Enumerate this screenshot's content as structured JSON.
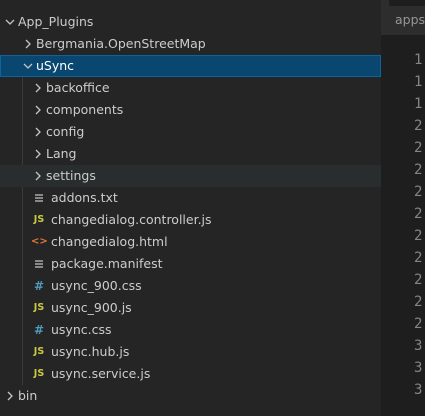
{
  "explorer": {
    "root_folder": "App_Plugins",
    "items": [
      {
        "label": "Bergmania.OpenStreetMap",
        "kind": "folder",
        "expanded": false
      },
      {
        "label": "uSync",
        "kind": "folder",
        "expanded": true,
        "selected": true
      },
      {
        "label": "backoffice",
        "kind": "folder",
        "expanded": false
      },
      {
        "label": "components",
        "kind": "folder",
        "expanded": false
      },
      {
        "label": "config",
        "kind": "folder",
        "expanded": false
      },
      {
        "label": "Lang",
        "kind": "folder",
        "expanded": false
      },
      {
        "label": "settings",
        "kind": "folder",
        "expanded": false,
        "hover": true
      },
      {
        "label": "addons.txt",
        "kind": "file",
        "icon": "lines-icon"
      },
      {
        "label": "changedialog.controller.js",
        "kind": "file",
        "icon": "js-icon"
      },
      {
        "label": "changedialog.html",
        "kind": "file",
        "icon": "html-icon"
      },
      {
        "label": "package.manifest",
        "kind": "file",
        "icon": "lines-icon"
      },
      {
        "label": "usync_900.css",
        "kind": "file",
        "icon": "css-icon"
      },
      {
        "label": "usync_900.js",
        "kind": "file",
        "icon": "js-icon"
      },
      {
        "label": "usync.css",
        "kind": "file",
        "icon": "css-icon"
      },
      {
        "label": "usync.hub.js",
        "kind": "file",
        "icon": "js-icon"
      },
      {
        "label": "usync.service.js",
        "kind": "file",
        "icon": "js-icon"
      },
      {
        "label": "bin",
        "kind": "folder",
        "expanded": false
      }
    ],
    "icon_glyphs": {
      "js": "JS",
      "css": "#",
      "html": "<>"
    }
  },
  "editor": {
    "tab_label": "appsettings",
    "line_number_digits": [
      "1",
      "1",
      "1",
      "2",
      "2",
      "2",
      "2",
      "2",
      "2",
      "2",
      "2",
      "2",
      "2",
      "3",
      "3",
      "3"
    ]
  },
  "colors": {
    "sidebar_bg": "#252526",
    "editor_bg": "#1e1e1e",
    "selection_bg": "#094771",
    "selection_border": "#0e639c",
    "js_icon": "#cbcb41",
    "css_icon": "#519aba",
    "html_icon": "#e37933"
  }
}
